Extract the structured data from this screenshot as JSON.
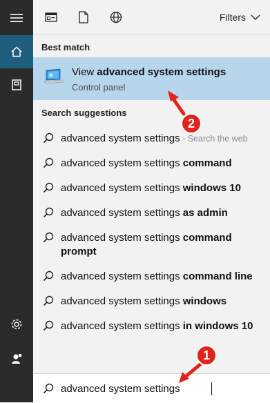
{
  "rail": {
    "items": [
      "hamburger-icon",
      "home-icon",
      "document-icon",
      "gear-icon",
      "user-icon"
    ]
  },
  "toolbar": {
    "filters_label": "Filters",
    "icons": [
      "apps-filter-icon",
      "document-filter-icon",
      "web-filter-icon"
    ]
  },
  "best_match": {
    "heading": "Best match",
    "title_prefix": "View ",
    "title_bold": "advanced system settings",
    "subtitle": "Control panel"
  },
  "suggestions": {
    "heading": "Search suggestions",
    "items": [
      {
        "base": "advanced system settings",
        "extra": "",
        "hint": " - Search the web"
      },
      {
        "base": "advanced system settings ",
        "extra": "command",
        "hint": ""
      },
      {
        "base": "advanced system settings ",
        "extra": "windows 10",
        "hint": ""
      },
      {
        "base": "advanced system settings ",
        "extra": "as admin",
        "hint": ""
      },
      {
        "base": "advanced system settings ",
        "extra": "command prompt",
        "hint": ""
      },
      {
        "base": "advanced system settings ",
        "extra": "command line",
        "hint": ""
      },
      {
        "base": "advanced system settings ",
        "extra": "windows",
        "hint": ""
      },
      {
        "base": "advanced system settings ",
        "extra": "in windows 10",
        "hint": ""
      }
    ]
  },
  "search": {
    "value": "advanced system settings"
  },
  "annotations": {
    "step1": "1",
    "step2": "2",
    "color": "#e0241c"
  },
  "colors": {
    "rail_bg": "#2b2b2b",
    "rail_active": "#1f5e7c",
    "highlight": "#b7d6ec"
  }
}
